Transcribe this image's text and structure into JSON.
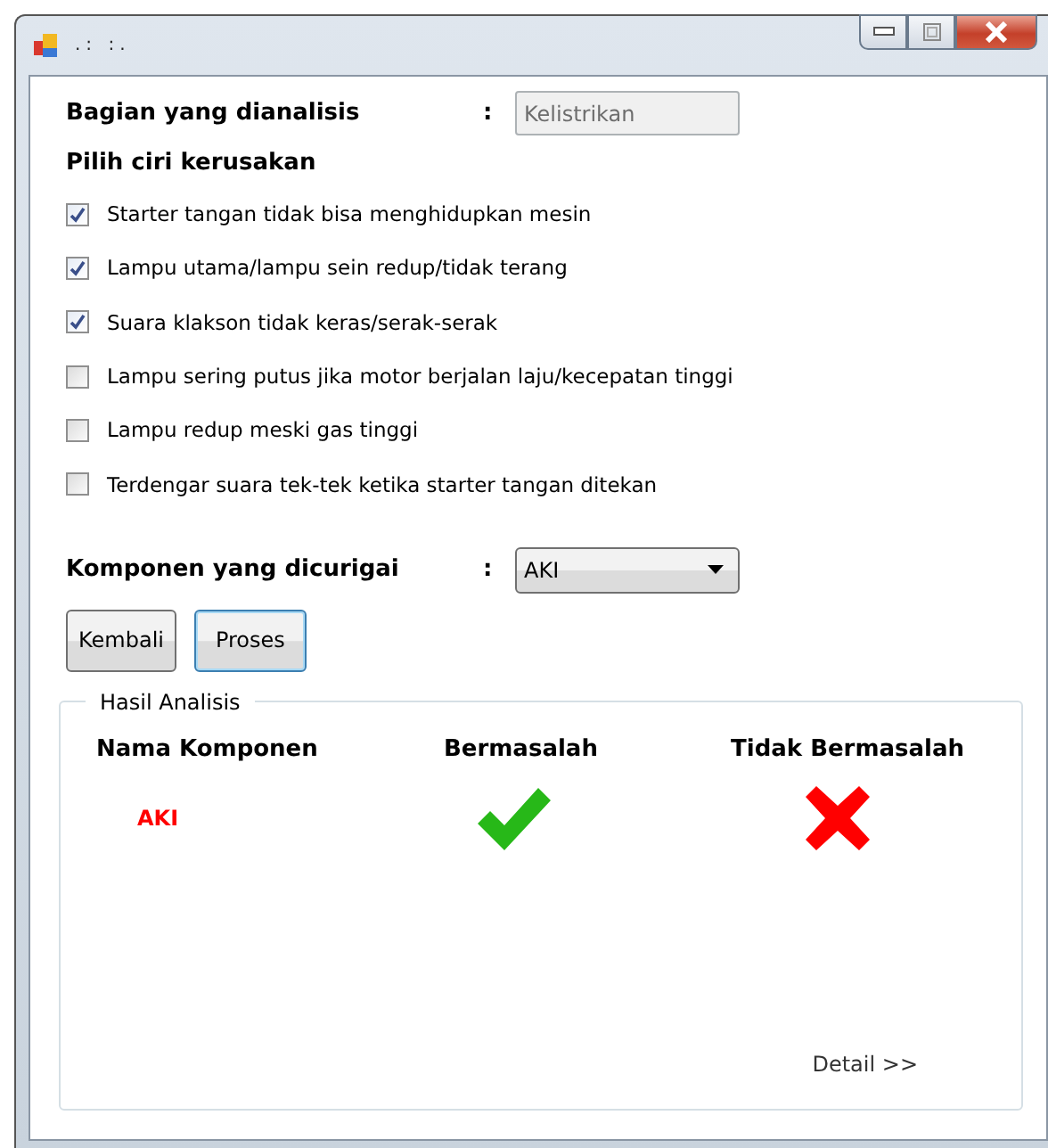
{
  "window": {
    "title": ".: :."
  },
  "analyzed_part": {
    "label": "Bagian yang dianalisis",
    "separator": ":",
    "value": "Kelistrikan"
  },
  "symptoms": {
    "heading": "Pilih ciri kerusakan",
    "items": [
      {
        "label": "Starter tangan tidak bisa menghidupkan mesin",
        "checked": true
      },
      {
        "label": "Lampu utama/lampu sein redup/tidak terang",
        "checked": true
      },
      {
        "label": "Suara klakson tidak keras/serak-serak",
        "checked": true
      },
      {
        "label": "Lampu sering putus jika motor berjalan laju/kecepatan tinggi",
        "checked": false
      },
      {
        "label": "Lampu redup meski gas tinggi",
        "checked": false
      },
      {
        "label": "Terdengar suara tek-tek ketika starter tangan ditekan",
        "checked": false
      }
    ]
  },
  "suspected": {
    "label": "Komponen yang dicurigai",
    "separator": ":",
    "value": "AKI"
  },
  "buttons": [
    {
      "label": "Kembali",
      "focused": false
    },
    {
      "label": "Proses",
      "focused": true
    }
  ],
  "result": {
    "title": "Hasil Analisis",
    "columns": [
      "Nama Komponen",
      "Bermasalah",
      "Tidak Bermasalah"
    ],
    "rows": [
      {
        "name": "AKI",
        "problem": true
      }
    ],
    "detail_link": "Detail >>"
  }
}
